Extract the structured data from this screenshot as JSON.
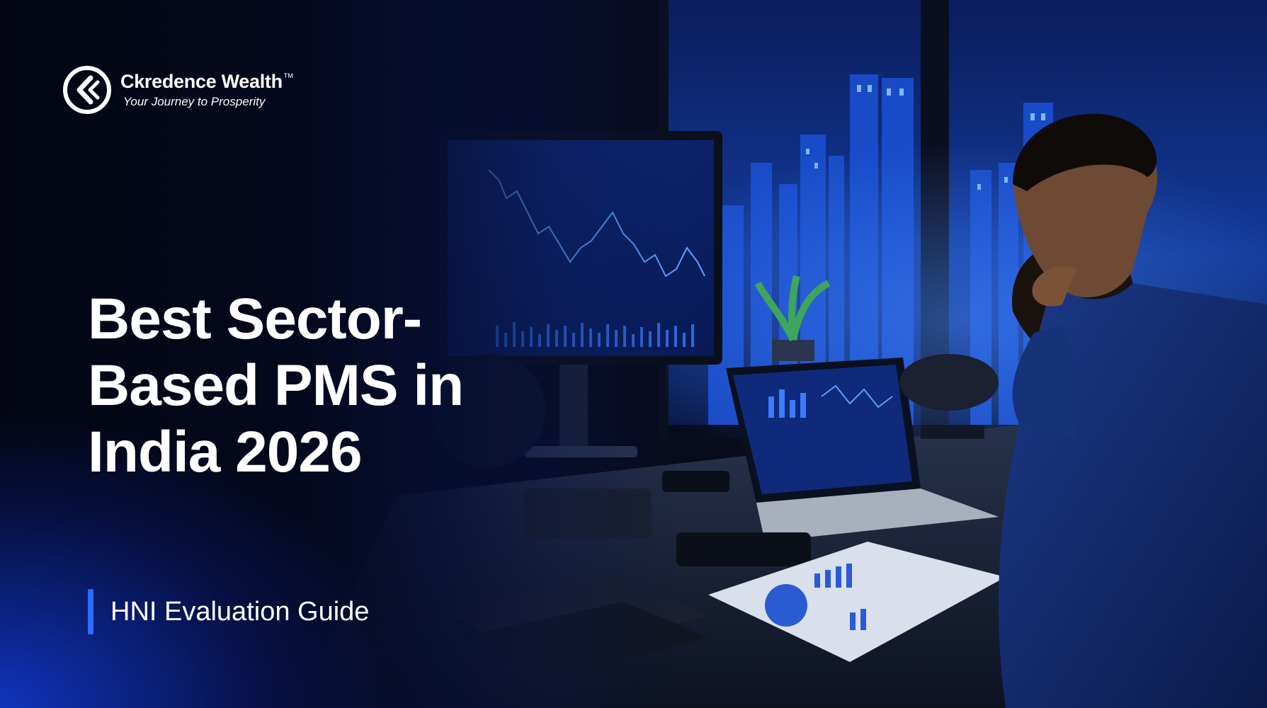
{
  "brand": {
    "name": "Ckredence Wealth",
    "trademark": "TM",
    "tagline": "Your Journey to Prosperity"
  },
  "headline": {
    "line1": "Best Sector-",
    "line2": "Based PMS in",
    "line3": "India 2026"
  },
  "subtitle": {
    "text": "HNI Evaluation Guide"
  },
  "colors": {
    "accent": "#2f6bff",
    "background": "#060a18",
    "text": "#ffffff"
  },
  "icons": [
    "ckredence-logo-icon"
  ]
}
